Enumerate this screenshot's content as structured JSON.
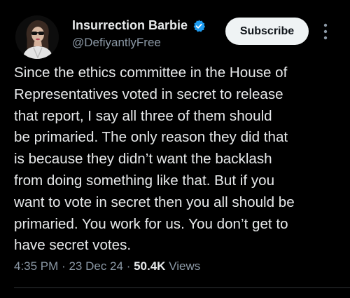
{
  "author": {
    "display_name": "Insurrection Barbie",
    "handle": "@DefiyantlyFree",
    "verified_icon": "verified-badge-icon",
    "avatar_icon": "profile-photo"
  },
  "actions": {
    "subscribe_label": "Subscribe",
    "more_icon": "more-options-icon"
  },
  "tweet": {
    "lines": [
      "Since the ethics committee in the House of",
      "Representatives voted in secret to release",
      "that report, I say all three of them should",
      "be primaried. The only reason they did that",
      "is because they didn’t want the backlash",
      "from doing something like that. But if you",
      "want to vote in secret then you all should be",
      "primaried. You work for us. You don’t get to",
      "have secret votes."
    ]
  },
  "meta": {
    "time": "4:35 PM",
    "separator": "·",
    "date": "23 Dec 24",
    "views_count": "50.4K",
    "views_label": "Views"
  },
  "colors": {
    "background": "#000000",
    "text": "#e7e9ea",
    "secondary_text": "#8b98a5",
    "verified_blue": "#1d9bf0",
    "subscribe_bg": "#eff3f4"
  }
}
